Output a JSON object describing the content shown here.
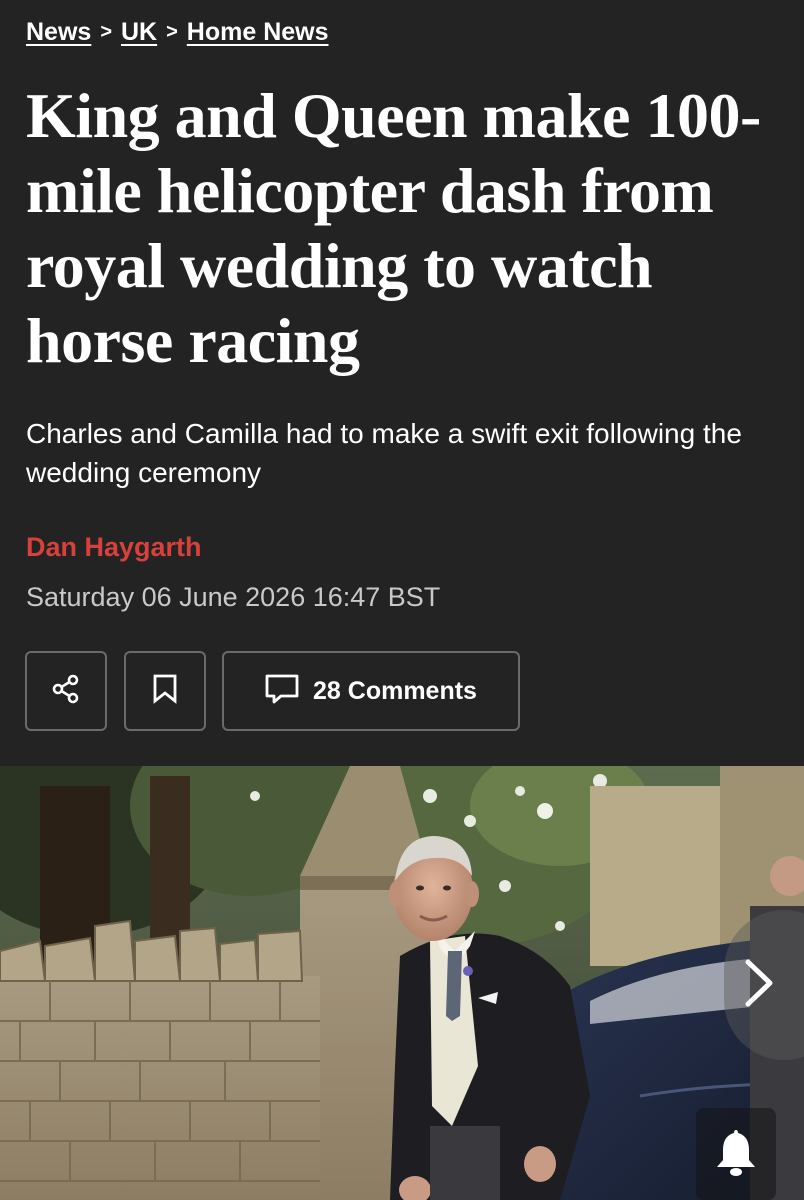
{
  "breadcrumb": {
    "items": [
      "News",
      "UK",
      "Home News"
    ],
    "separator": ">"
  },
  "article": {
    "headline": "King and Queen make 100-mile helicopter dash from royal wedding to watch horse racing",
    "standfirst": "Charles and Camilla had to make a swift exit following the wedding ceremony",
    "author": "Dan Haygarth",
    "date": "Saturday 06 June 2026 16:47 BST"
  },
  "actions": {
    "share_icon": "share-icon",
    "bookmark_icon": "bookmark-icon",
    "comments_icon": "comment-icon",
    "comments_label": "28 Comments"
  },
  "gallery": {
    "next_icon": "chevron-right-icon",
    "notification_icon": "bell-icon"
  },
  "colors": {
    "background": "#232323",
    "author_accent": "#d8413b",
    "date_text": "#c9c9c9",
    "button_border": "#6a6a6a"
  }
}
